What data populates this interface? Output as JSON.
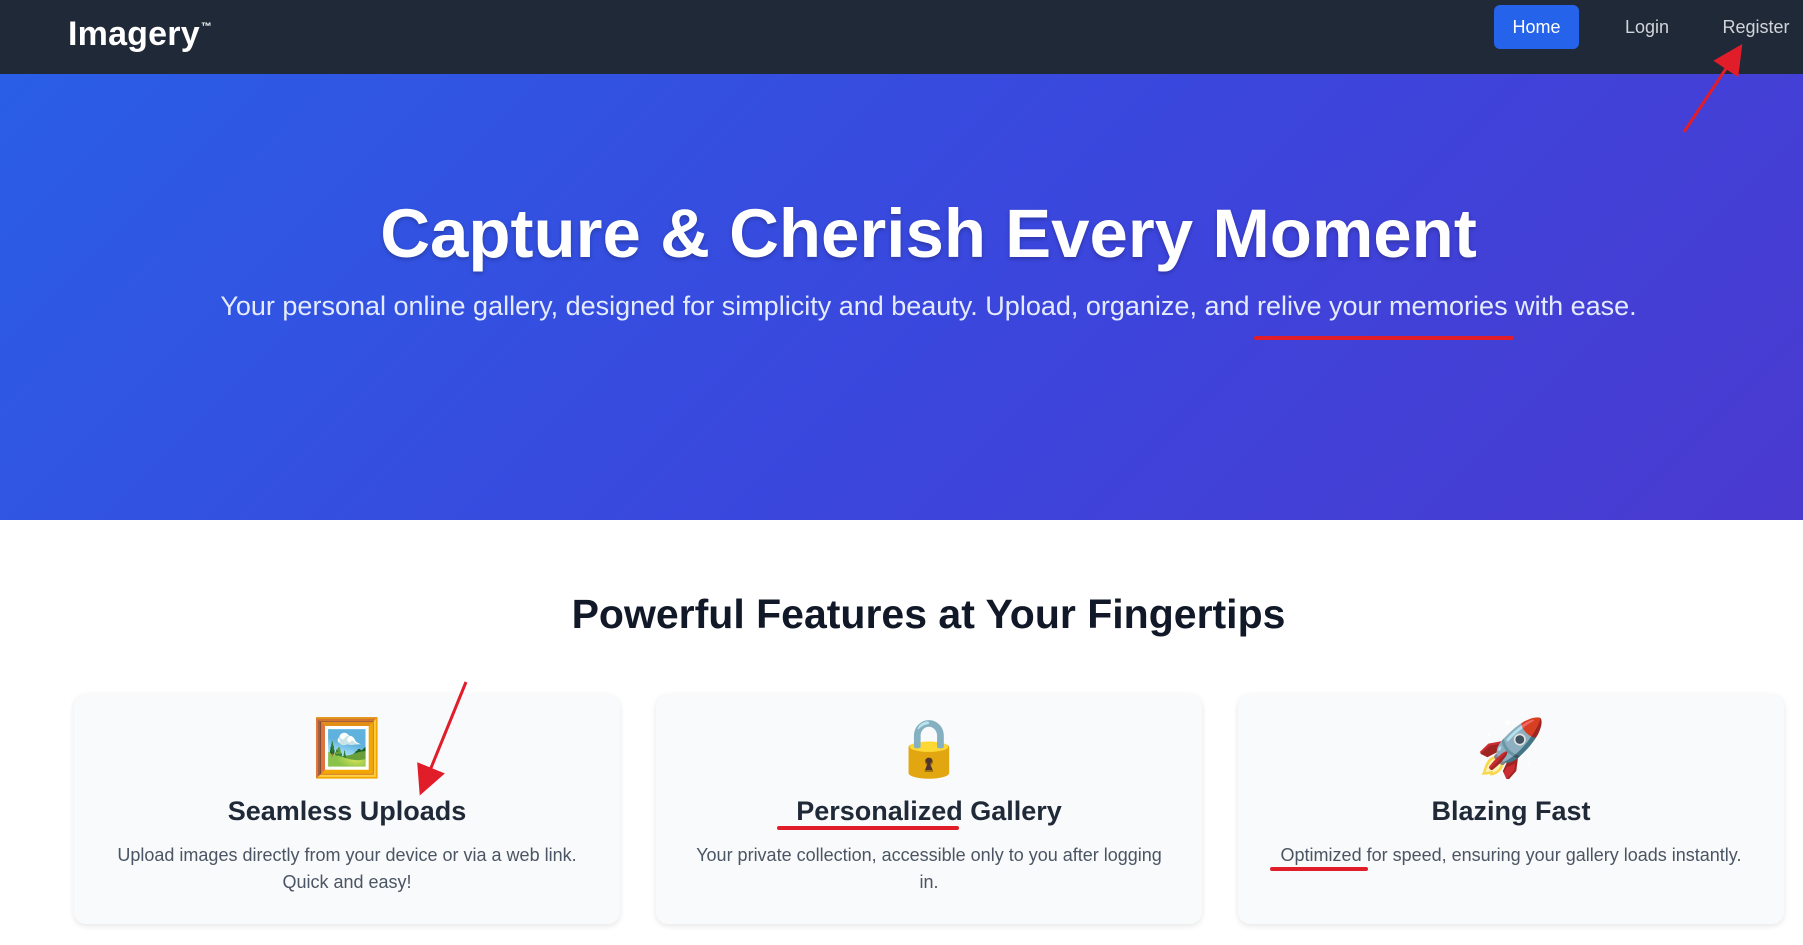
{
  "navbar": {
    "brand": "Imagery",
    "brand_tm": "™",
    "links": [
      {
        "label": "Home"
      },
      {
        "label": "Login"
      },
      {
        "label": "Register"
      }
    ]
  },
  "hero": {
    "title": "Capture & Cherish Every Moment",
    "subtitle": "Your personal online gallery, designed for simplicity and beauty. Upload, organize, and relive your memories with ease."
  },
  "features": {
    "title": "Powerful Features at Your Fingertips",
    "cards": [
      {
        "icon": "🖼️",
        "icon_name": "framed-picture-icon",
        "title": "Seamless Uploads",
        "description": "Upload images directly from your device or via a web link. Quick and easy!"
      },
      {
        "icon": "🔒",
        "icon_name": "lock-icon",
        "title": "Personalized Gallery",
        "description": "Your private collection, accessible only to you after logging in."
      },
      {
        "icon": "🚀",
        "icon_name": "rocket-icon",
        "title": "Blazing Fast",
        "description": "Optimized for speed, ensuring your gallery loads instantly."
      }
    ]
  },
  "colors": {
    "navbar_bg": "#1f2937",
    "accent": "#2563eb",
    "hero_gradient_start": "#2a5ee6",
    "hero_gradient_end": "#4a3ad0",
    "annotation": "#e11d2a"
  }
}
